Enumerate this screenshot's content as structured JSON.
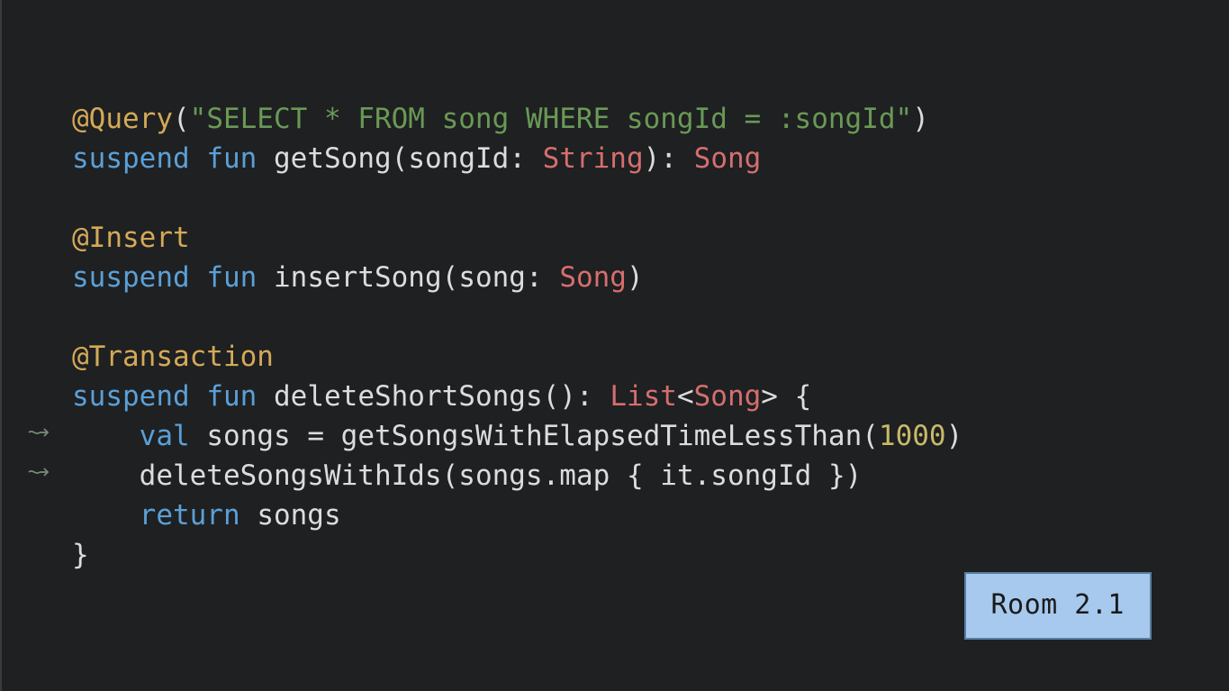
{
  "code": {
    "query_annotation": "@Query",
    "query_open_paren": "(",
    "query_string": "\"SELECT * FROM song WHERE songId = :songId\"",
    "query_close_paren": ")",
    "suspend": "suspend",
    "fun": "fun",
    "getSong": "getSong",
    "songId_param": "songId",
    "string_type": "String",
    "song_type": "Song",
    "insert_annotation": "@Insert",
    "insertSong": "insertSong",
    "song_param": "song",
    "transaction_annotation": "@Transaction",
    "deleteShortSongs": "deleteShortSongs",
    "list_type": "List",
    "val": "val",
    "songs_var": "songs",
    "getSongsWithElapsed": "getSongsWithElapsedTimeLessThan",
    "thousand": "1000",
    "deleteSongsWithIds": "deleteSongsWithIds",
    "map": "map",
    "it": "it",
    "songId_prop": "songId",
    "return": "return",
    "open_brace": "{",
    "close_brace": "}",
    "open_paren": "(",
    "close_paren": ")",
    "colon": ":",
    "comma": ",",
    "eq": "=",
    "dot": ".",
    "lt": "<",
    "gt": ">"
  },
  "badge": {
    "label": "Room 2.1"
  }
}
